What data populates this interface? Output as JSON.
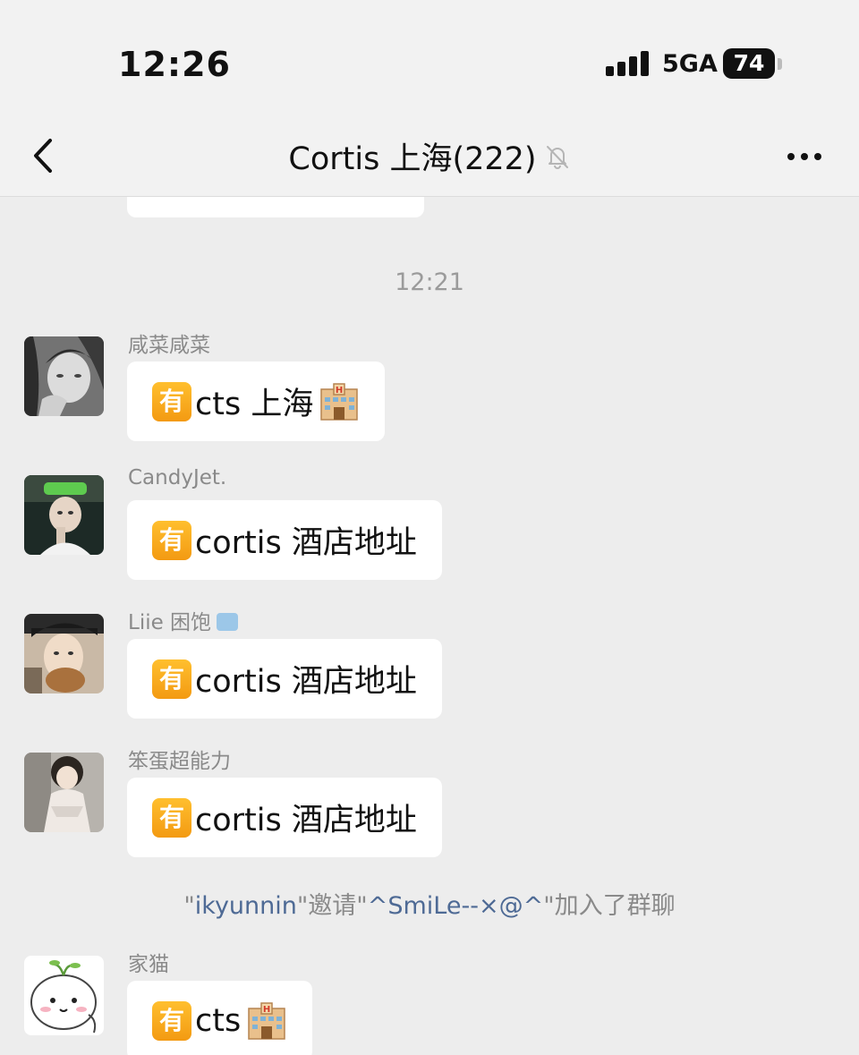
{
  "status_bar": {
    "time": "12:26",
    "network": "5GA",
    "battery": "74"
  },
  "nav": {
    "title": "Cortis 上海(222)",
    "back_icon": "chevron-left-icon",
    "mute_icon": "bell-off-icon",
    "more_icon": "ellipsis-icon"
  },
  "chat": {
    "time_divider": "12:21",
    "badge_char": "有",
    "messages": [
      {
        "sender": "咸菜咸菜",
        "text": "cts 上海",
        "has_hotel_emoji": true
      },
      {
        "sender": "CandyJet.",
        "text": "cortis 酒店地址",
        "has_hotel_emoji": false
      },
      {
        "sender": "Liie 困饱",
        "text": "cortis 酒店地址",
        "has_hotel_emoji": false
      },
      {
        "sender": "笨蛋超能力",
        "text": "cortis 酒店地址",
        "has_hotel_emoji": false
      },
      {
        "sender": "家猫",
        "text": "cts",
        "has_hotel_emoji": true
      }
    ],
    "system_message": {
      "q1": "\"",
      "inviter": "ikyunnin",
      "mid": "\"邀请\"",
      "invitee": "^SmiLe--×@^",
      "tail": "\"加入了群聊"
    }
  },
  "colors": {
    "background": "#ededed",
    "bubble": "#ffffff",
    "badge": "#f6a722",
    "link_name": "#4e6a95"
  }
}
